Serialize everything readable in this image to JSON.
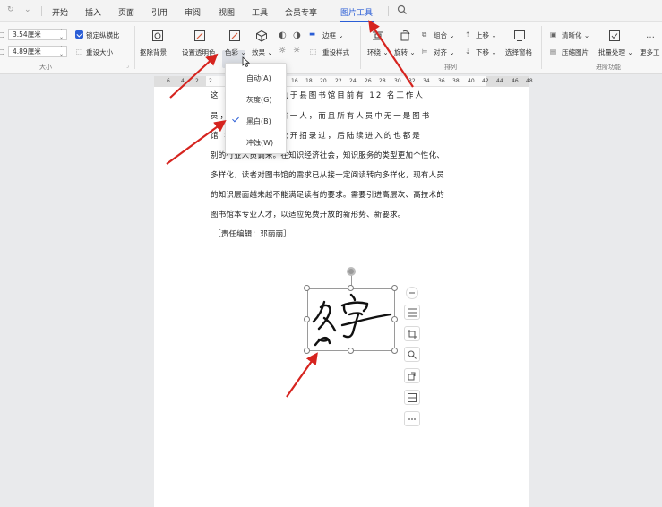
{
  "tabs": [
    "开始",
    "插入",
    "页面",
    "引用",
    "审阅",
    "视图",
    "工具",
    "会员专享",
    "图片工具"
  ],
  "active_tab": "图片工具",
  "size_group": {
    "height_value": "3.54厘米",
    "width_value": "4.89厘米",
    "lock_ratio_label": "锁定纵横比",
    "reset_size_label": "重设大小",
    "label": "大小"
  },
  "image_buttons": {
    "remove_bg": "抠除背景",
    "set_transparent": "设置透明色",
    "color": "色彩",
    "effects": "效果",
    "border": "边框",
    "reset_style": "重设样式"
  },
  "arrange": {
    "wrap": "环绕",
    "rotate": "旋转",
    "group": "组合",
    "align": "对齐",
    "bring_up": "上移",
    "send_down": "下移",
    "selection_pane": "选择窗格",
    "label": "排列"
  },
  "advanced": {
    "clarify": "清晰化",
    "compress": "压缩图片",
    "batch": "批量处理",
    "more": "更多工",
    "label": "进阶功能"
  },
  "ruler_numbers": [
    "6",
    "4",
    "2",
    "2",
    "12",
    "14",
    "16",
    "18",
    "20",
    "22",
    "24",
    "26",
    "28",
    "30",
    "32",
    "34",
    "36",
    "38",
    "40",
    "42",
    "44",
    "46",
    "48"
  ],
  "color_menu": {
    "items": [
      {
        "label": "自动(A)",
        "checked": false
      },
      {
        "label": "灰度(G)",
        "checked": false
      },
      {
        "label": "黑白(B)",
        "checked": true
      },
      {
        "label": "冲蚀(W)",
        "checked": false
      }
    ]
  },
  "document": {
    "lines": [
      "这                  的开供问题，执于县图书馆目前有 12 名工作人",
      "员，              毕业人员只有一人，而且所有人员中无一是图书",
      "馆                年以来，没有公开招录过，后陆续进入的也都是",
      "别的行业人员调来。在知识经济社会，知识服务的类型更加个性化、",
      "多样化，读者对图书馆的需求已从接一定阅读转向多样化，现有人员",
      "的知识层面越来越不能满足读者的要求。需要引进高层次、高技术的",
      "图书馆本专业人才，以适应免费开放的新形势、新要求。",
      "［责任编辑：邓丽丽］"
    ]
  },
  "colors": {
    "accent": "#2b5ed6",
    "arrow": "#d6241f"
  }
}
